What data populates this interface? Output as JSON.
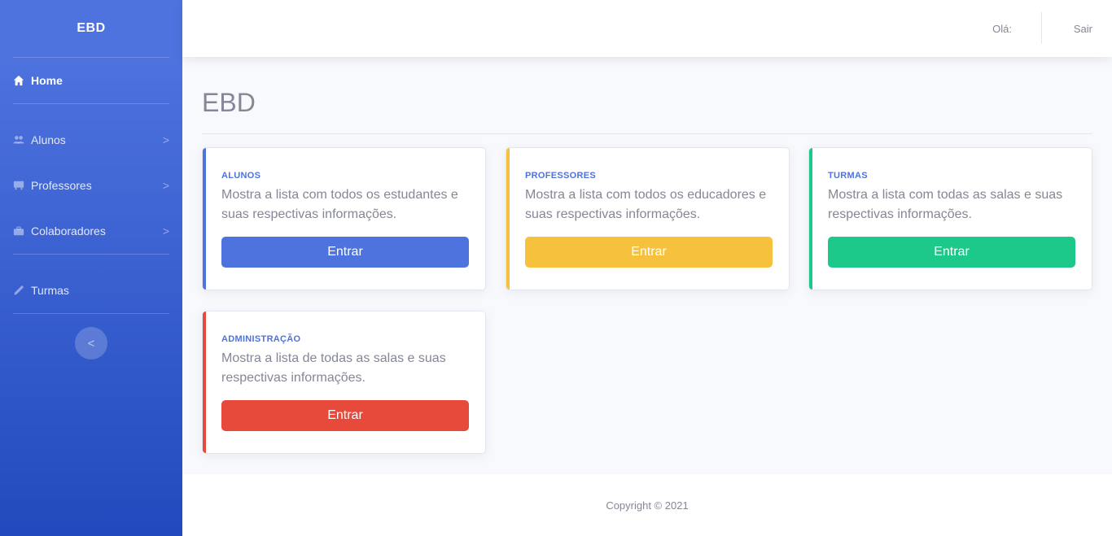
{
  "sidebar": {
    "brand": "EBD",
    "items": [
      {
        "label": "Home",
        "icon": "home-icon",
        "chevron": ""
      },
      {
        "label": "Alunos",
        "icon": "users-icon",
        "chevron": ">"
      },
      {
        "label": "Professores",
        "icon": "chalkboard-icon",
        "chevron": ">"
      },
      {
        "label": "Colaboradores",
        "icon": "briefcase-icon",
        "chevron": ">"
      },
      {
        "label": "Turmas",
        "icon": "pen-icon",
        "chevron": ""
      }
    ],
    "toggle_label": "<"
  },
  "topbar": {
    "greeting": "Olá:",
    "logout_label": "Sair"
  },
  "main": {
    "title": "EBD",
    "cards": [
      {
        "kicker": "ALUNOS",
        "description": "Mostra a lista com todos os estudantes e suas respectivas informações.",
        "button_label": "Entrar",
        "color": "#4e73df"
      },
      {
        "kicker": "PROFESSORES",
        "description": "Mostra a lista com todos os educadores e suas respectivas informações.",
        "button_label": "Entrar",
        "color": "#f6c23e"
      },
      {
        "kicker": "TURMAS",
        "description": "Mostra a lista com todas as salas e suas respectivas informações.",
        "button_label": "Entrar",
        "color": "#1cc88a"
      },
      {
        "kicker": "ADMINISTRAÇÃO",
        "description": "Mostra a lista de todas as salas e suas respectivas informações.",
        "button_label": "Entrar",
        "color": "#e74a3b"
      }
    ]
  },
  "footer": {
    "copyright": "Copyright © 2021"
  },
  "colors": {
    "primary": "#4e73df",
    "warning": "#f6c23e",
    "success": "#1cc88a",
    "danger": "#e74a3b"
  }
}
